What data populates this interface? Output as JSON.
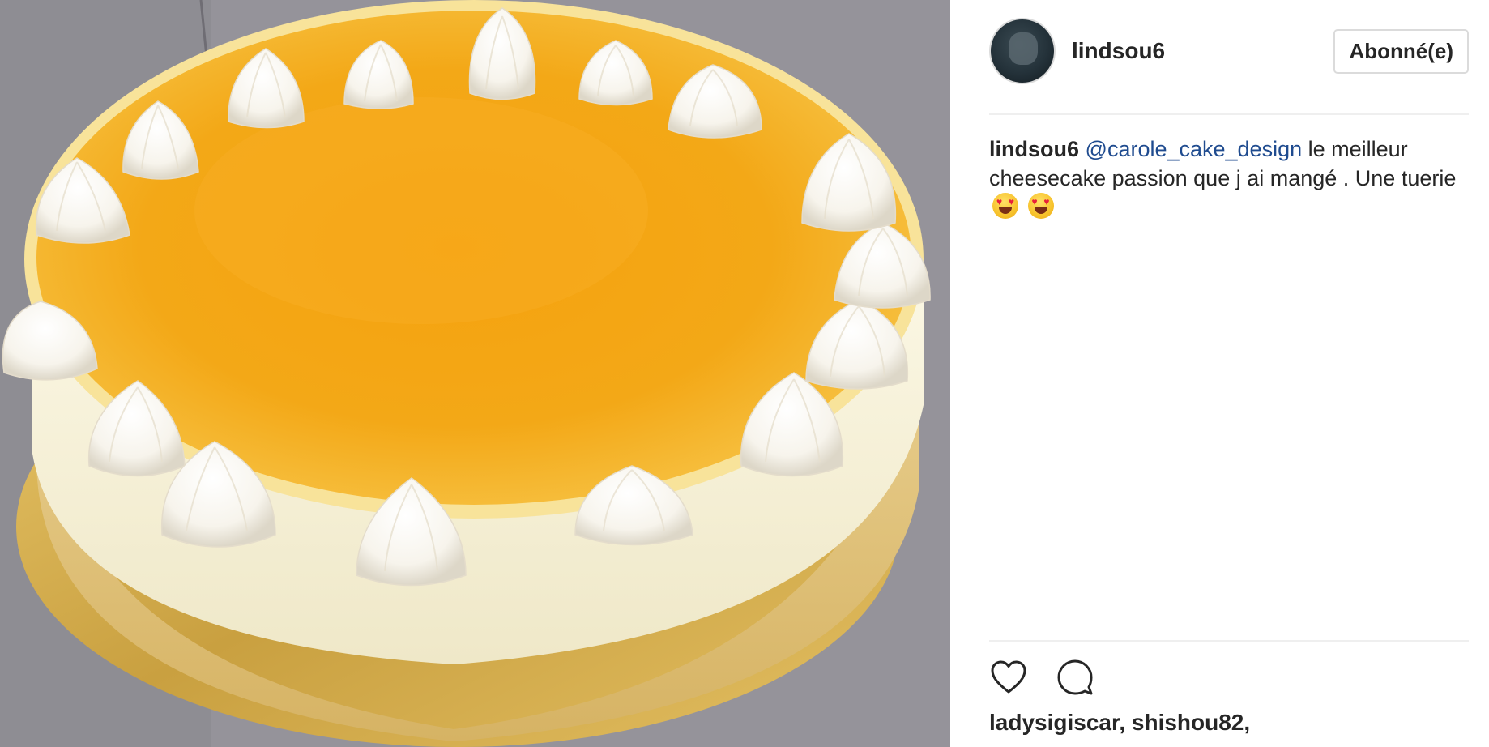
{
  "post": {
    "user": {
      "username": "lindsou6",
      "follow_button_label": "Abonné(e)"
    },
    "image": {
      "subject": "cheesecake passion"
    },
    "caption": {
      "username": "lindsou6",
      "mention": "@carole_cake_design",
      "text": "le meilleur cheesecake passion que j ai mangé . Une tuerie",
      "emojis": [
        "heart-eyes-emoji",
        "heart-eyes-emoji"
      ]
    },
    "actions": {
      "like_icon": "heart-icon",
      "comment_icon": "comment-bubble-icon"
    },
    "likes": {
      "text": "ladysigiscar, shishou82,"
    }
  },
  "colors": {
    "text": "#262626",
    "mention": "#1f4b8f",
    "divider": "#efefef",
    "button_border": "#dbdbdb",
    "glaze": "#f2a414",
    "photo_background": "#97959a"
  }
}
